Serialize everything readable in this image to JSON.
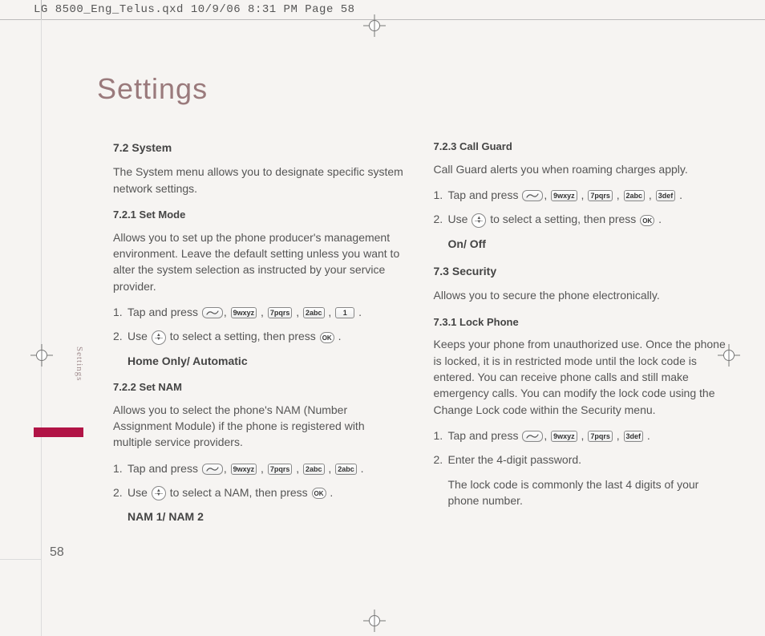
{
  "doc": {
    "header_slug": "LG 8500_Eng_Telus.qxd  10/9/06  8:31 PM  Page 58",
    "title": "Settings",
    "side_label": "Settings",
    "page_number": "58"
  },
  "keys": {
    "k9": "9wxyz",
    "k7": "7pqrs",
    "k2": "2abc",
    "k1": "1",
    "k3": "3def",
    "ok": "OK"
  },
  "left": {
    "h_system": "7.2 System",
    "p_system": "The System menu allows you to designate specific system network settings.",
    "h_setmode": "7.2.1 Set Mode",
    "p_setmode": "Allows you to set up the phone producer's management environment. Leave the default setting unless you want to alter the system selection as instructed by your service provider.",
    "step1_lead": "Tap and press ",
    "step2a": "Use ",
    "step2b": " to select a setting, then press ",
    "opt_setmode": "Home Only/ Automatic",
    "h_setnam": "7.2.2 Set NAM",
    "p_setnam": "Allows you to select the phone's NAM (Number Assignment Module) if the phone is registered with multiple service providers.",
    "step2nam_b": " to select a NAM, then press ",
    "opt_setnam": "NAM 1/ NAM 2"
  },
  "right": {
    "h_callguard": "7.2.3 Call Guard",
    "p_callguard": "Call Guard alerts you when roaming charges apply.",
    "step2b": " to select a setting, then press ",
    "opt_callguard": "On/ Off",
    "h_security": "7.3 Security",
    "p_security": "Allows you to secure the phone electronically.",
    "h_lockphone": "7.3.1 Lock Phone",
    "p_lockphone": "Keeps your phone from unauthorized use. Once the phone is locked, it is in restricted mode until the lock code is entered. You can receive phone calls and still make emergency calls. You can modify the lock code using the Change Lock code within the Security menu.",
    "step2_lock": "Enter the 4-digit password.",
    "p_lockhint": "The lock code is commonly the last 4 digits of your phone number."
  },
  "labels": {
    "n1": "1.",
    "n2": "2.",
    "comma": " , ",
    "period": " ."
  }
}
